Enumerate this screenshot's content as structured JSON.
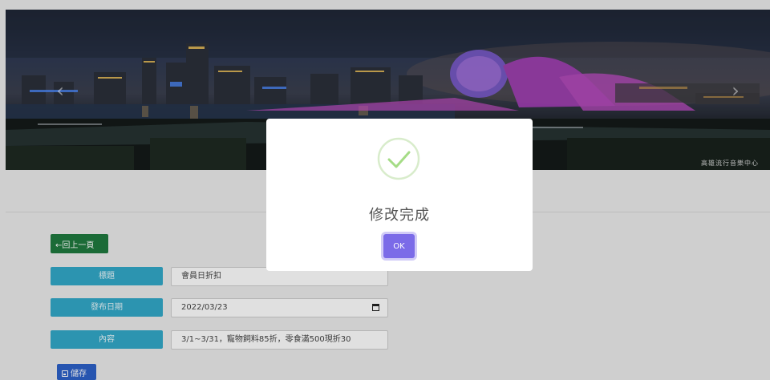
{
  "banner": {
    "prev_arrow": "‹",
    "next_arrow": "›",
    "caption": "高雄流行音樂中心"
  },
  "form": {
    "back_label": "←回上一頁",
    "fields": [
      {
        "label": "標題",
        "value": "會員日折扣"
      },
      {
        "label": "發布日期",
        "value": "2022/03/23"
      },
      {
        "label": "內容",
        "value": "3/1~3/31，寵物飼料85折，零食滿500現折30"
      }
    ],
    "save_label": "儲存"
  },
  "dialog": {
    "title": "修改完成",
    "ok_label": "OK",
    "icon": "success-check-icon"
  },
  "colors": {
    "back_button": "#1f7a3f",
    "field_label": "#33a9c9",
    "save_button": "#2d61c9",
    "ok_button": "#7b6be8",
    "success": "#a5dc86"
  }
}
